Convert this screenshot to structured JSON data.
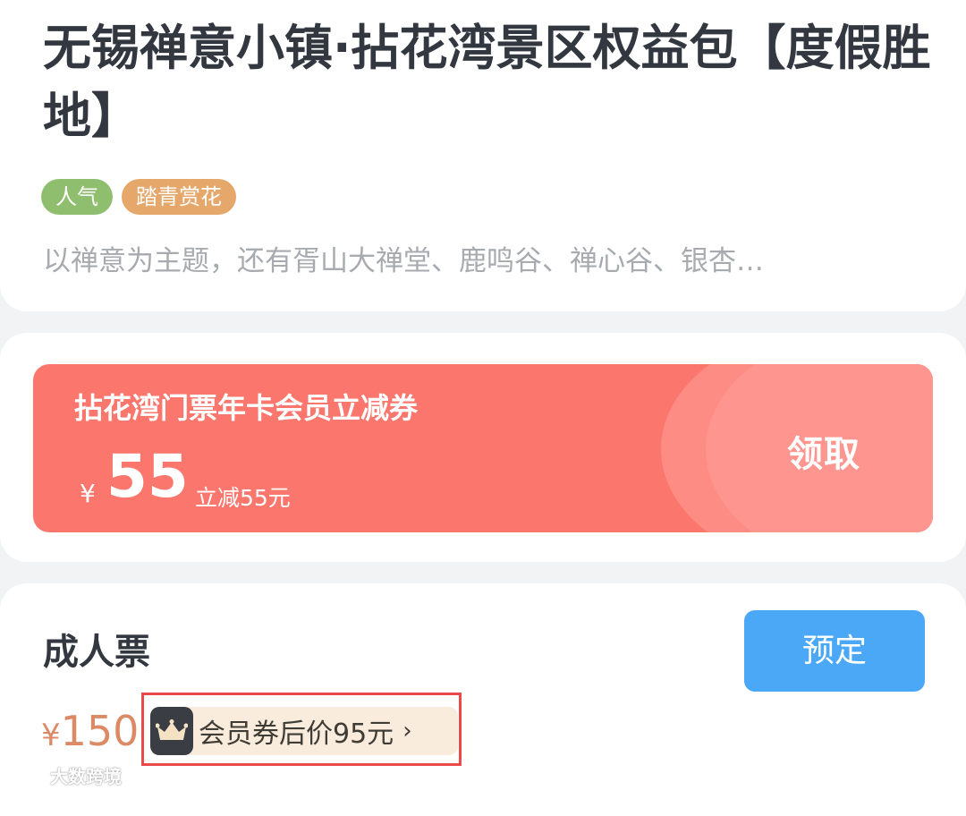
{
  "product": {
    "title": "无锡禅意小镇·拈花湾景区权益包【度假胜地】",
    "tags": [
      "人气",
      "踏青赏花"
    ],
    "description": "以禅意为主题，还有胥山大禅堂、鹿鸣谷、禅心谷、银杏…"
  },
  "coupon": {
    "name": "拈花湾门票年卡会员立减券",
    "currency": "¥",
    "amount": "55",
    "subtitle": "立减55元",
    "claim_label": "领取"
  },
  "ticket": {
    "name": "成人票",
    "currency": "¥",
    "price": "150",
    "book_label": "预定",
    "member_price_text": "会员券后价95元",
    "chevron": "›"
  },
  "watermark": {
    "text": "大数跨境"
  },
  "colors": {
    "coupon_bg": "#fb776e",
    "book_button": "#4aa8f7",
    "tag_green": "#8fbf6e",
    "tag_orange": "#e6a76b",
    "price": "#dc8a66",
    "highlight_border": "#e94948"
  }
}
